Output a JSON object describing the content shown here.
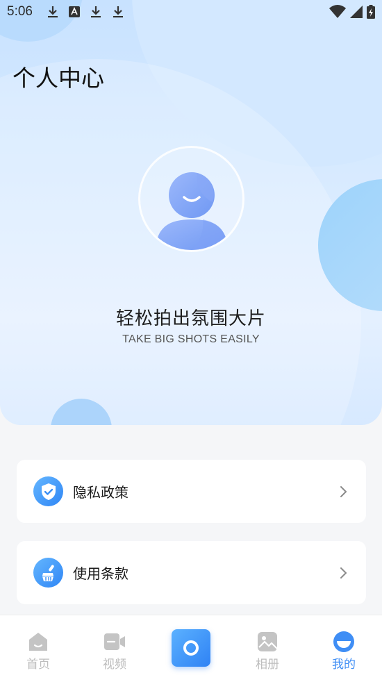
{
  "status_bar": {
    "time": "5:06"
  },
  "header": {
    "title": "个人中心"
  },
  "profile": {
    "slogan": "轻松拍出氛围大片",
    "slogan_en": "TAKE BIG SHOTS EASILY"
  },
  "menu": [
    {
      "label": "隐私政策",
      "icon": "shield-check-icon"
    },
    {
      "label": "使用条款",
      "icon": "brush-icon"
    }
  ],
  "tabs": [
    {
      "label": "首页",
      "icon": "home-icon",
      "active": false
    },
    {
      "label": "视频",
      "icon": "video-icon",
      "active": false
    },
    {
      "label": "",
      "icon": "camera-icon",
      "active": false
    },
    {
      "label": "相册",
      "icon": "album-icon",
      "active": false
    },
    {
      "label": "我的",
      "icon": "profile-icon",
      "active": true
    }
  ],
  "colors": {
    "accent": "#3f8ef5",
    "inactive": "#bdbdbd"
  }
}
